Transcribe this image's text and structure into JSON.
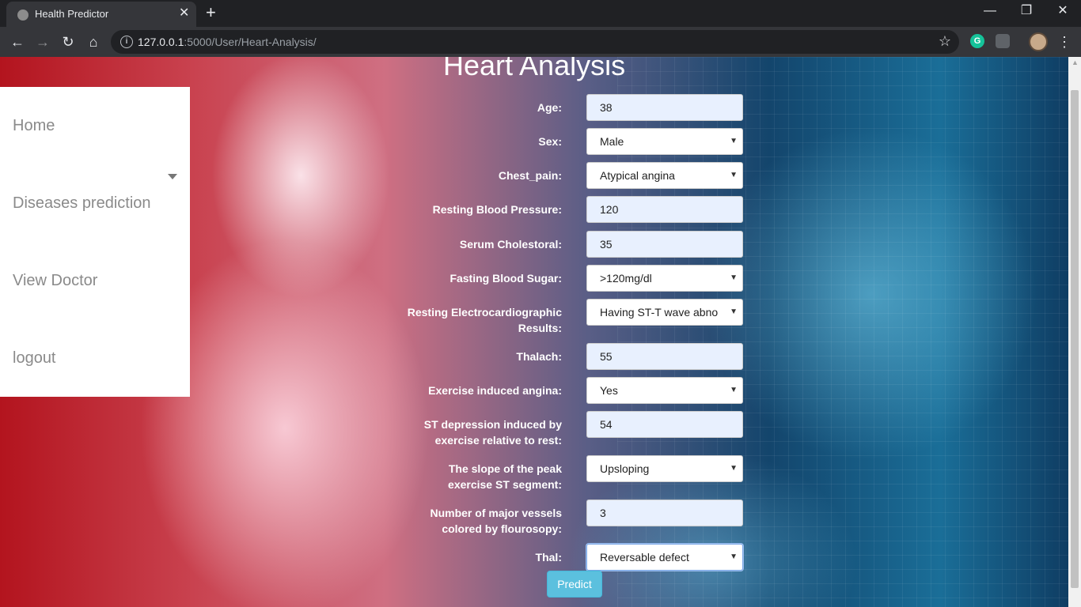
{
  "browser": {
    "tab_title": "Health Predictor",
    "tab_close": "✕",
    "new_tab": "+",
    "url_host": "127.0.0.1",
    "url_rest": ":5000/User/Heart-Analysis/",
    "ext_grammarly": "G",
    "window_min": "—",
    "window_restore": "❐",
    "window_close": "✕"
  },
  "sidebar": {
    "items": [
      {
        "label": "Home"
      },
      {
        "label": "Diseases prediction"
      },
      {
        "label": "View Doctor"
      },
      {
        "label": "logout"
      }
    ]
  },
  "page": {
    "title": "Heart Analysis",
    "predict_label": "Predict"
  },
  "form": {
    "fields": [
      {
        "label": "Age:",
        "value": "38",
        "type": "input"
      },
      {
        "label": "Sex:",
        "value": "Male",
        "type": "select"
      },
      {
        "label": "Chest_pain:",
        "value": "Atypical angina",
        "type": "select"
      },
      {
        "label": "Resting Blood Pressure:",
        "value": "120",
        "type": "input"
      },
      {
        "label": "Serum Cholestoral:",
        "value": "35",
        "type": "input"
      },
      {
        "label": "Fasting Blood Sugar:",
        "value": ">120mg/dl",
        "type": "select"
      },
      {
        "label_line1": "Resting Electrocardiographic",
        "label_line2": "Results:",
        "value": "Having ST-T wave abno",
        "type": "select"
      },
      {
        "label": "Thalach:",
        "value": "55",
        "type": "input"
      },
      {
        "label": "Exercise induced angina:",
        "value": "Yes",
        "type": "select"
      },
      {
        "label_line1": "ST depression induced by",
        "label_line2": "exercise relative to rest:",
        "value": "54",
        "type": "input"
      },
      {
        "label_line1": "The slope of the peak",
        "label_line2": "exercise ST segment:",
        "value": "Upsloping",
        "type": "select"
      },
      {
        "label_line1": "Number of major vessels",
        "label_line2": "colored by flourosopy:",
        "value": "3",
        "type": "input"
      },
      {
        "label": "Thal:",
        "value": "Reversable defect",
        "type": "select"
      }
    ]
  },
  "icons": {
    "select_arrow": "▼",
    "back": "←",
    "forward": "→",
    "reload": "↻",
    "home": "⌂",
    "star": "☆",
    "info": "i",
    "menu": "⋮",
    "scroll_up": "▲"
  }
}
